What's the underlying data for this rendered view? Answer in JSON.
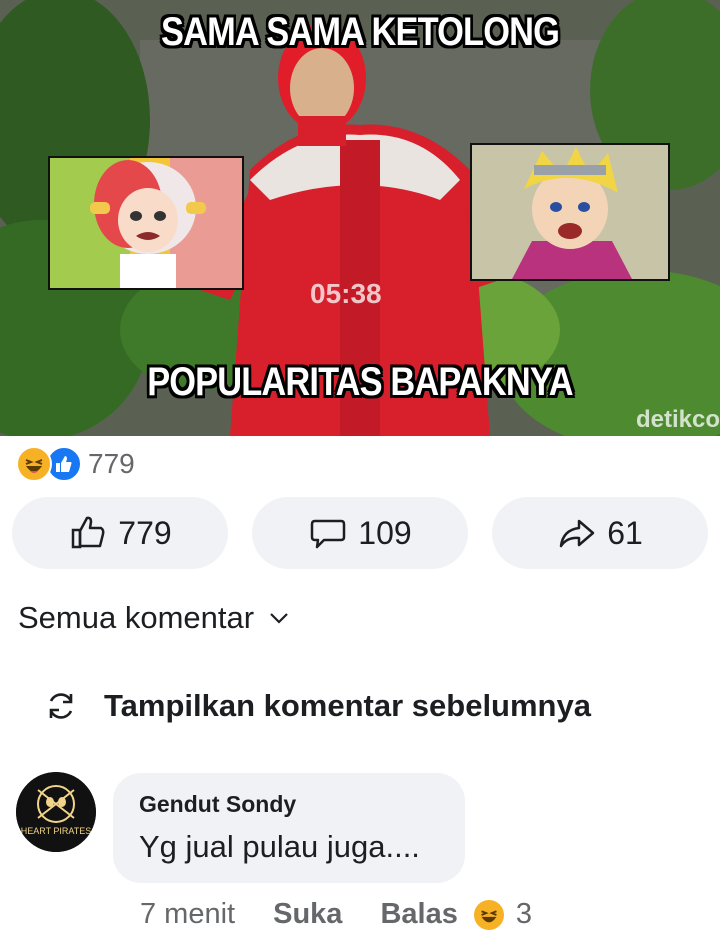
{
  "meme": {
    "caption_top": "SAMA SAMA KETOLONG",
    "caption_bottom": "POPULARITAS BAPAKNYA",
    "timestamp_overlay": "05:38",
    "watermark": "detikco"
  },
  "reactions": {
    "icons": [
      "haha-emoji-icon",
      "like-icon"
    ],
    "count": "779"
  },
  "actions": {
    "like_count": "779",
    "comment_count": "109",
    "share_count": "61"
  },
  "comments_section": {
    "filter_label": "Semua komentar",
    "previous_label": "Tampilkan komentar sebelumnya"
  },
  "comment": {
    "author": "Gendut Sondy",
    "text": "Yg jual pulau juga....",
    "avatar_text": "HEART PIRATES",
    "time": "7 menit",
    "like_label": "Suka",
    "reply_label": "Balas",
    "reaction_count": "3"
  },
  "colors": {
    "accent": "#1877f2",
    "haha": "#f7b125",
    "pill_bg": "#f0f2f5",
    "meta_text": "#65676b"
  }
}
